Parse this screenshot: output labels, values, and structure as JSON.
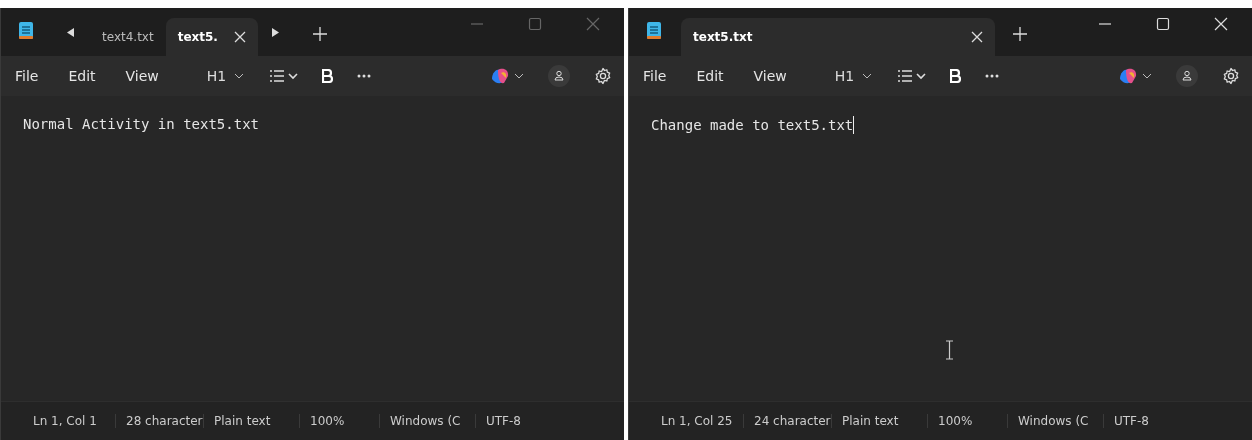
{
  "windows": [
    {
      "scroll_arrows": true,
      "tabs": [
        {
          "label": "text4.txt",
          "selected": false,
          "closable": false
        },
        {
          "label": "text5.",
          "selected": true,
          "closable": true
        }
      ],
      "menu": [
        "File",
        "Edit",
        "View"
      ],
      "toolbar": {
        "heading": "H1"
      },
      "editor": {
        "text": "Normal Activity in text5.txt",
        "caret": false,
        "pointer": false
      },
      "status": [
        "Ln 1, Col 1",
        "28 character",
        "Plain text",
        "100%",
        "Windows (C",
        "UTF-8"
      ]
    },
    {
      "scroll_arrows": false,
      "tabs": [
        {
          "label": "text5.txt",
          "selected": true,
          "closable": true
        }
      ],
      "menu": [
        "File",
        "Edit",
        "View"
      ],
      "toolbar": {
        "heading": "H1"
      },
      "editor": {
        "text": "Change made to text5.txt",
        "caret": true,
        "pointer": true
      },
      "status": [
        "Ln 1, Col 25",
        "24 character",
        "Plain text",
        "100%",
        "Windows (C",
        "UTF-8"
      ]
    }
  ]
}
